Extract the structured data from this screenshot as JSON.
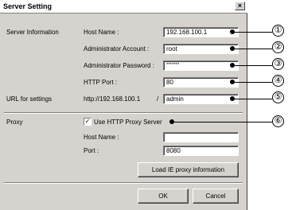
{
  "window": {
    "title": "Server Setting",
    "close_glyph": "×"
  },
  "server_info": {
    "section_label": "Server Information",
    "host_name": {
      "label": "Host Name :",
      "value": "192.168.100.1"
    },
    "admin_account": {
      "label": "Administrator Account :",
      "value": "root"
    },
    "admin_password": {
      "label": "Administrator Password :",
      "value": "*******"
    },
    "http_port": {
      "label": "HTTP Port :",
      "value": "80"
    }
  },
  "url_settings": {
    "section_label": "URL for settings",
    "prefix": "http://192.168.100.1",
    "slash": "/",
    "value": "admin"
  },
  "proxy": {
    "section_label": "Proxy",
    "use_proxy_label": "Use HTTP Proxy Server",
    "use_proxy_checked": true,
    "check_glyph": "✓",
    "host_name": {
      "label": "Host Name :",
      "value": ""
    },
    "port": {
      "label": "Port :",
      "value": "8080"
    },
    "load_button": "Load IE proxy information"
  },
  "buttons": {
    "ok": "OK",
    "cancel": "Cancel"
  },
  "callouts": [
    "①",
    "②",
    "③",
    "④",
    "⑤",
    "⑥"
  ],
  "colors": {
    "dialog_bg": "#d6d3ce",
    "callout": "#000000"
  }
}
